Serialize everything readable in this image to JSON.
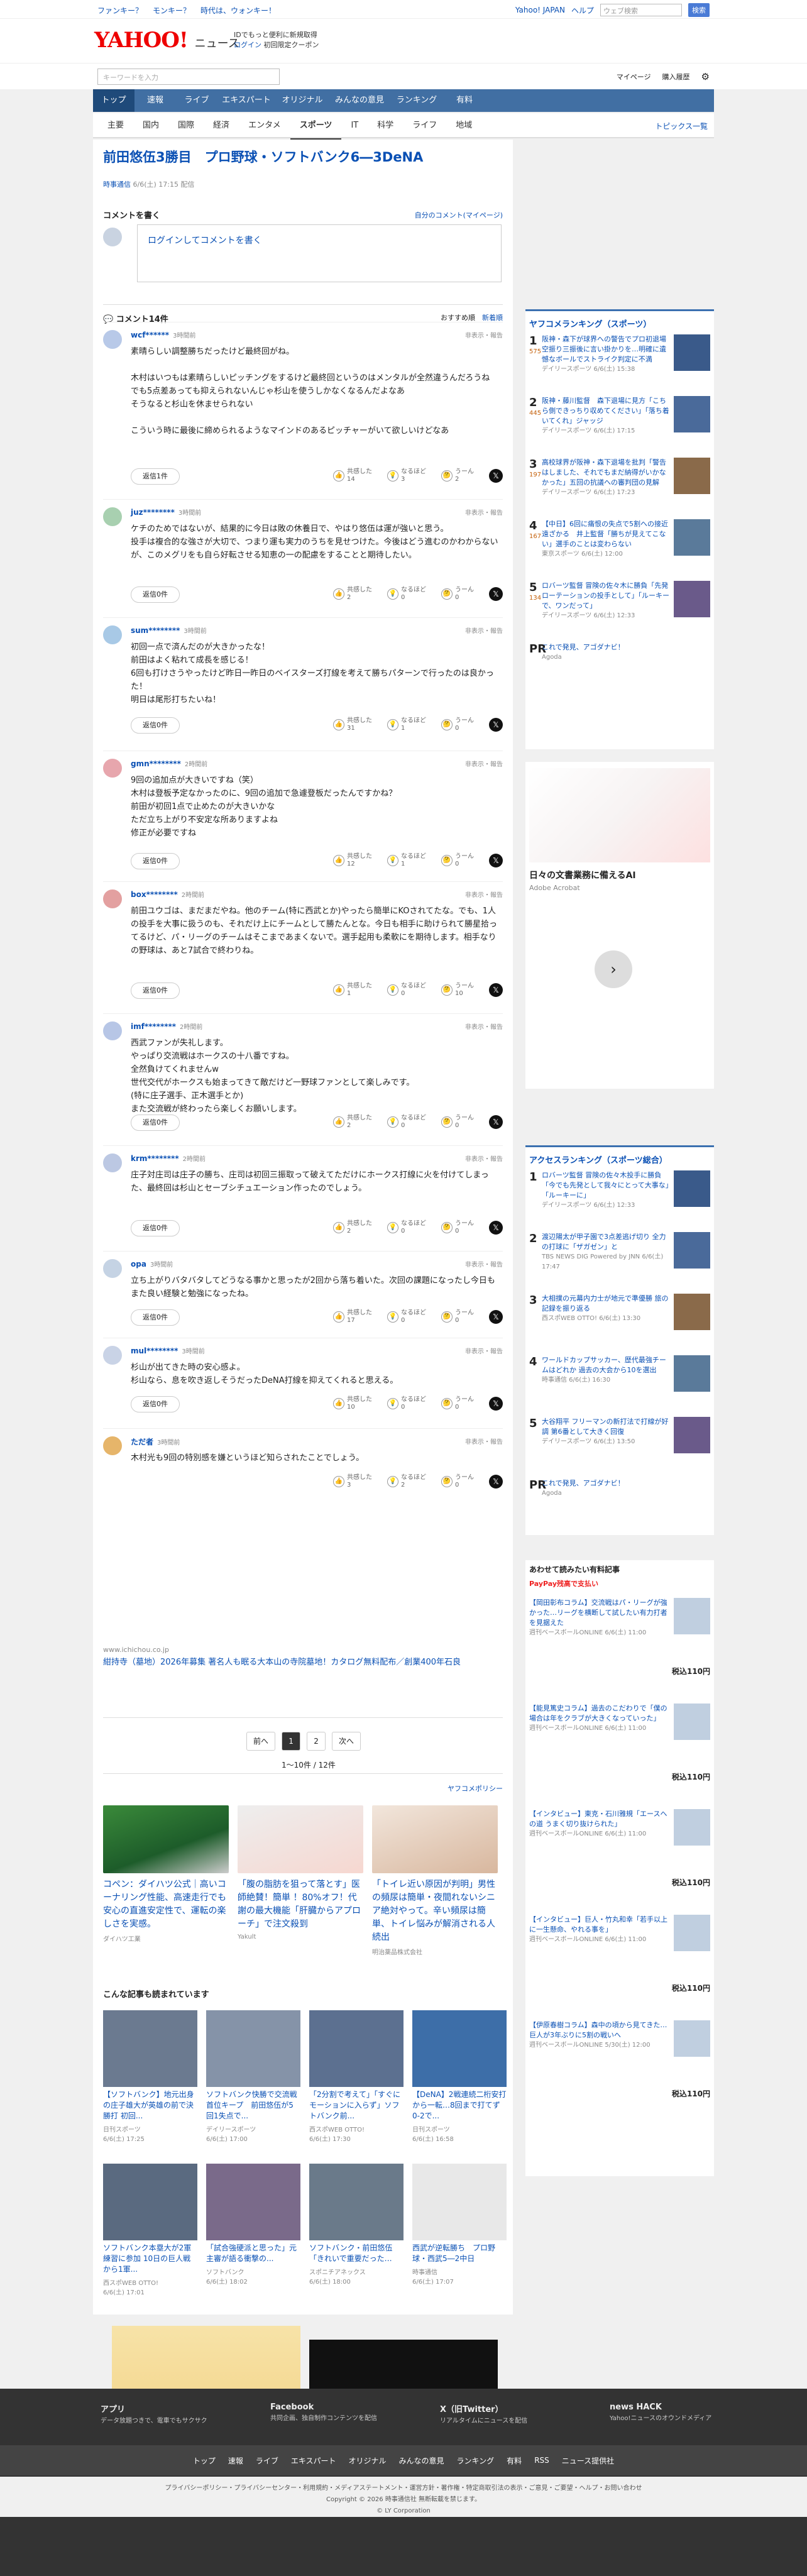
{
  "top_strip": {
    "links": [
      "ファンキー？",
      "モンキー？",
      "時代は、ウォンキー！"
    ],
    "right_links": [
      "Yahoo! JAPAN",
      "ヘルプ"
    ],
    "search_placeholder": "ウェブ検索",
    "search_btn": "検索"
  },
  "header": {
    "logo": "YAHOO!",
    "logo_sub": "ニュース",
    "info1": "IDでもっと便利に新規取得",
    "info2": "ログイン",
    "info3": "初回限定クーポン"
  },
  "subbar": {
    "placeholder": "キーワードを入力",
    "mypage": "マイページ",
    "history": "購入履歴"
  },
  "nav1": [
    "トップ",
    "速報",
    "ライブ",
    "エキスパート",
    "オリジナル",
    "みんなの意見",
    "ランキング",
    "有料"
  ],
  "nav2": [
    "主要",
    "国内",
    "国際",
    "経済",
    "エンタメ",
    "スポーツ",
    "IT",
    "科学",
    "ライフ",
    "地域"
  ],
  "nav2_right": "トピックス一覧",
  "article": {
    "title": "前田悠伍3勝目　プロ野球・ソフトバンク6―3DeNA",
    "source": "時事通信",
    "date": "6/6(土) 17:15 配信"
  },
  "comment_write": {
    "heading": "コメントを書く",
    "mypage": "自分のコメント(マイページ)",
    "placeholder": "ログインしてコメントを書く"
  },
  "comments_head": {
    "title": "コメント14件",
    "sort1": "おすすめ順",
    "sort2": "新着順"
  },
  "comments": [
    {
      "user": "wcf******",
      "time": "3時間前",
      "report": "非表示・報告",
      "text": "素晴らしい調整勝ちだったけど最終回がね。\n\n木村はいつもは素晴らしいピッチングをするけど最終回というのはメンタルが全然違うんだろうね\nでも5点差あっても抑えられないんじゃ杉山を使うしかなくなるんだよなあ\nそうなると杉山を休ませられない\n\nこういう時に最後に締められるようなマインドのあるピッチャーがいて欲しいけどなあ",
      "replies": "返信1件",
      "counts": [
        "14",
        "3",
        "2"
      ]
    },
    {
      "user": "juz********",
      "time": "3時間前",
      "report": "非表示・報告",
      "text": "ケチのためではないが、結果的に今日は敗の休養日で、やはり悠伍は運が強いと思う。\n投手は複合的な強さが大切で、つまり運も実力のうちを見せつけた。今後はどう進むのかわからないが、このメグリをも自ら好転させる知恵の一の配慮をすることと期待したい。",
      "replies": "返信0件",
      "counts": [
        "2",
        "0",
        "0"
      ]
    },
    {
      "user": "sum********",
      "time": "3時間前",
      "report": "非表示・報告",
      "text": "初回一点で済んだのが大きかったな！\n前田はよく粘れて成長を感じる！\n6回も打けさうやったけど昨日一昨日のベイスターズ打線を考えて勝ちパターンで行ったのは良かった！\n明日は尾形打ちたいね！",
      "replies": "返信0件",
      "counts": [
        "31",
        "1",
        "0"
      ]
    },
    {
      "user": "gmn********",
      "time": "2時間前",
      "report": "非表示・報告",
      "text": "9回の追加点が大きいですね（笑）\n木村は登板予定なかったのに、9回の追加で急遽登板だったんですかね？\n前田が初回1点で止めたのが大きいかな\nただ立ち上がり不安定な所ありますよね\n修正が必要ですね",
      "replies": "返信0件",
      "counts": [
        "12",
        "1",
        "0"
      ]
    },
    {
      "user": "box********",
      "time": "2時間前",
      "report": "非表示・報告",
      "text": "前田ユウゴは、まだまだやね。他のチーム(特に西武とか)やったら簡単にKOされてたな。でも、1人の投手を大事に扱うのも、それだけ上にチームとして勝たんとな。今日も相手に助けられて勝星拾ってるけど、パ・リーグのチームはそこまであまくないで。選手起用も柔軟にを期待します。相手なりの野球は、あと7試合で終わりね。",
      "replies": "返信0件",
      "counts": [
        "1",
        "0",
        "10"
      ]
    },
    {
      "user": "imf********",
      "time": "2時間前",
      "report": "非表示・報告",
      "text": "西武ファンが失礼します。\nやっぱり交流戦はホークスの十八番ですね。\n全然負けてくれませんw\n世代交代がホークスも始まってきて敵だけど一野球ファンとして楽しみです。\n(特に庄子選手、正木選手とか)\nまた交流戦が終わったら楽しくお願いします。",
      "replies": "返信0件",
      "counts": [
        "2",
        "0",
        "0"
      ]
    },
    {
      "user": "krm********",
      "time": "2時間前",
      "report": "非表示・報告",
      "text": "庄子対庄司は庄子の勝ち、庄司は初回三振取って破えてただけにホークス打線に火を付けてしまった、最終回は杉山とセーブシチュエーション作ったのでしょう。",
      "replies": "返信0件",
      "counts": [
        "2",
        "0",
        "0"
      ]
    },
    {
      "user": "opa",
      "time": "3時間前",
      "report": "非表示・報告",
      "text": "立ち上がりバタバタしてどうなる事かと思ったが2回から落ち着いた。次回の課題になったし今日もまた良い経験と勉強になったね。",
      "replies": "返信0件",
      "counts": [
        "17",
        "0",
        "0"
      ]
    },
    {
      "user": "mul********",
      "time": "3時間前",
      "report": "非表示・報告",
      "text": "杉山が出てきた時の安心感よ。\n杉山なら、息を吹き返しそうだったDeNA打線を抑えてくれると思える。",
      "replies": "返信0件",
      "counts": [
        "10",
        "0",
        "0"
      ]
    },
    {
      "user": "ただ者",
      "time": "3時間前",
      "report": "非表示・報告",
      "text": "木村光も9回の特別感を嫌というほど知らされたことでしょう。",
      "replies": "",
      "counts": [
        "3",
        "2",
        "0"
      ]
    }
  ],
  "comment_act_labels": {
    "agree": "共感した",
    "learn": "なるほど",
    "hmm": "うーん"
  },
  "ad_inline": {
    "domain": "www.ichichou.co.jp",
    "title": "紺持寺（墓地）2026年募集 著名人も眠る大本山の寺院墓地！カタログ無料配布／創業400年石良"
  },
  "pager": {
    "prev": "前へ",
    "p1": "1",
    "p2": "2",
    "next": "次へ",
    "count": "1〜10件 / 12件"
  },
  "policy": "ヤフコメポリシー",
  "ad_cards": [
    {
      "title": "コペン：ダイハツ公式｜高いコーナリング性能、高速走行でも安心の直進安定性で、運転の楽しさを実感。",
      "source": "ダイハツ工業"
    },
    {
      "title": "「腹の脂肪を狙って落とす」医師絶賛！簡単 ！80%オフ！代謝の最大機能「肝臓からアプローチ」で注文殺到",
      "source": "Yakult"
    },
    {
      "title": "「トイレ近い原因が判明」男性の頻尿は簡単・夜間れないシニア絶対やって。辛い頻尿は簡単、トイレ悩みが解消される人続出",
      "source": "明治薬品株式会社"
    }
  ],
  "mostread_title": "こんな記事も読まれています",
  "mostread": [
    {
      "title": "【ソフトバンク】地元出身の庄子雄大が英雄の前で決勝打 初回...",
      "src": "日刊スポーツ",
      "date": "6/6(土) 17:25"
    },
    {
      "title": "ソフトバンク快勝で交流戦首位キープ　前田悠伍が5回1失点で...",
      "src": "デイリースポーツ",
      "date": "6/6(土) 17:00"
    },
    {
      "title": "「2分割で考えて」「すぐにモーションに入らず」ソフトバンク前...",
      "src": "西スポWEB OTTO!",
      "date": "6/6(土) 17:30"
    },
    {
      "title": "【DeNA】2戦連続二桁安打から一転…8回まで打てず0-2で...",
      "src": "日刊スポーツ",
      "date": "6/6(土) 16:58"
    },
    {
      "title": "ソフトバンク本塁大が2軍練習に参加 10日の巨人戦から1軍...",
      "src": "西スポWEB OTTO!",
      "date": "6/6(土) 17:01"
    },
    {
      "title": "「試合強硬派と思った」元主審が語る衝撃の...",
      "src": "ソフトバンク",
      "date": "6/6(土) 18:02"
    },
    {
      "title": "ソフトバンク・前田悠伍「きれいで重要だった…",
      "src": "スポニチアネックス",
      "date": "6/6(土) 18:00"
    },
    {
      "title": "西武が逆転勝ち　プロ野球・西武5―2中日",
      "src": "時事通信",
      "date": "6/6(土) 17:07"
    }
  ],
  "side_ranking": {
    "title": "ヤフコメランキング（スポーツ）",
    "items": [
      {
        "num": "1",
        "cnt": "575",
        "t": "阪神・森下が球界への警告でプロ初退場　空振り三振後に言い掛かりを…明確に遺憾なボールでストライク判定に不満",
        "s": "デイリースポーツ 6/6(土) 15:38"
      },
      {
        "num": "2",
        "cnt": "445",
        "t": "阪神・藤川監督　森下退場に見方「こちら側できっちり収めてください」「落ち着いてくれ」ジャッジ",
        "s": "デイリースポーツ 6/6(土) 17:15"
      },
      {
        "num": "3",
        "cnt": "197",
        "t": "高校球界が阪神・森下退場を批判「警告はしました、それでもまだ納得がいかなかった」五回の抗議への審判団の見解",
        "s": "デイリースポーツ 6/6(土) 17:23"
      },
      {
        "num": "4",
        "cnt": "167",
        "t": "【中日】6回に痛恨の失点で5割への接近遠ざかる　井上監督「勝ちが見えてこない」選手のことは変わらない",
        "s": "東京スポーツ 6/6(土) 12:00"
      },
      {
        "num": "5",
        "cnt": "134",
        "t": "ロバーツ監督 冒険の佐々木に勝負「先発ローテーションの投手として」「ルーキーで、ワンだって」",
        "s": "デイリースポーツ 6/6(土) 12:33"
      }
    ],
    "pr": "これで発見、アゴダナビ！",
    "pr_src": "Agoda"
  },
  "side_ad": {
    "title": "日々の文書業務に備えるAI",
    "src": "Adobe Acrobat"
  },
  "access_ranking": {
    "title": "アクセスランキング（スポーツ総合）",
    "items": [
      {
        "num": "1",
        "t": "ロバーツ監督 冒険の佐々木投手に勝負「今でも先発として我々にとって大事な」「ルーキーに」",
        "s": "デイリースポーツ 6/6(土) 12:33"
      },
      {
        "num": "2",
        "t": "渡辺陽太が甲子園で3点差逃げ切り 全力の打球に「ザガゼン」と",
        "s": "TBS NEWS DIG Powered by JNN 6/6(土) 17:47"
      },
      {
        "num": "3",
        "t": "大相撲の元幕内力士が地元で準優勝 旅の記録を振り返る",
        "s": "西スポWEB OTTO! 6/6(土) 13:30"
      },
      {
        "num": "4",
        "t": "ワールドカップサッカー、歴代最強チームはどれか 過去の大会から10を選出",
        "s": "時事通信 6/6(土) 16:30"
      },
      {
        "num": "5",
        "t": "大谷翔平 フリーマンの新打法で打線が好調 第6番として大きく回復",
        "s": "デイリースポーツ 6/6(土) 13:50"
      }
    ],
    "pr": "これで発見、アゴダナビ！",
    "pr_src": "Agoda"
  },
  "shop": {
    "title": "あわせて読みたい有料記事",
    "brand": "PayPay残高で支払い",
    "price_label": "税込",
    "items": [
      {
        "t": "【岡田彰布コラム】交流戦はパ・リーグが強かった…リーグを横断して試したい有力打者を見据えた",
        "s": "週刊ベースボールONLINE 6/6(土) 11:00",
        "p": "110円"
      },
      {
        "t": "【能見篤史コラム】過去のこだわりで「僕の場合は年をクラブが大きくなっていった」",
        "s": "週刊ベースボールONLINE 6/6(土) 11:00",
        "p": "110円"
      },
      {
        "t": "【インタビュー】東克・石川雅規「エースへの道 うまく切り抜けられた」",
        "s": "週刊ベースボールONLINE 6/6(土) 11:00",
        "p": "110円"
      },
      {
        "t": "【インタビュー】巨人・竹丸和幸「若手以上に一生懸命、やれる事を」",
        "s": "週刊ベースボールONLINE 6/6(土) 11:00",
        "p": "110円"
      },
      {
        "t": "【伊原春樹コラム】森中の頃から見てきた…巨人が3年ぶりに5割の戦いへ",
        "s": "週刊ベースボールONLINE 5/30(土) 12:00",
        "p": "110円"
      }
    ]
  },
  "footer": {
    "cols": [
      {
        "t": "アプリ",
        "d": "データ放題つきで、電車でもサクサク"
      },
      {
        "t": "Facebook",
        "d": "共同企画、独自制作コンテンツを配信"
      },
      {
        "t": "X（旧Twitter）",
        "d": "リアルタイムにニュースを配信"
      },
      {
        "t": "news HACK",
        "d": "Yahoo!ニュースのオウンドメディア"
      }
    ],
    "nav": [
      "トップ",
      "速報",
      "ライブ",
      "エキスパート",
      "オリジナル",
      "みんなの意見",
      "ランキング",
      "有料",
      "RSS",
      "ニュース提供社"
    ],
    "links": "プライバシーポリシー・プライバシーセンター・利用規約・メディアステートメント・運営方針・著作権・特定商取引法の表示・ご意見・ご要望・ヘルプ・お問い合わせ",
    "copy": "Copyright © 2026 時事通信社 無断転載を禁じます。",
    "copy2": "© LY Corporation"
  }
}
